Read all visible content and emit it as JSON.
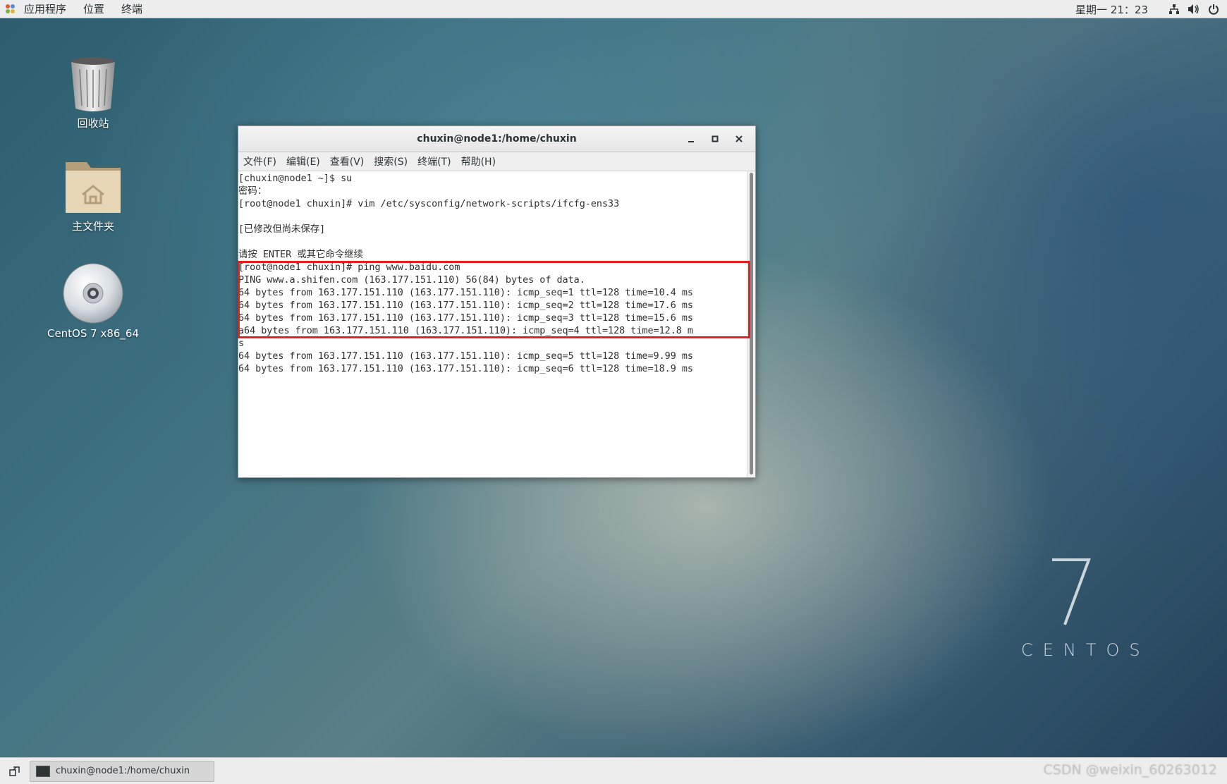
{
  "top_panel": {
    "menus": [
      "应用程序",
      "位置",
      "终端"
    ],
    "clock": "星期一 21：23",
    "tray_icons": [
      "network-icon",
      "volume-icon",
      "power-icon"
    ]
  },
  "desktop": {
    "icons": [
      {
        "label": "回收站",
        "icon": "trash-icon"
      },
      {
        "label": "主文件夹",
        "icon": "home-folder-icon"
      },
      {
        "label": "CentOS 7 x86_64",
        "icon": "disc-icon"
      }
    ],
    "brand_number": "7",
    "brand_word": "CENTOS"
  },
  "window": {
    "title": "chuxin@node1:/home/chuxin",
    "menu": [
      "文件(F)",
      "编辑(E)",
      "查看(V)",
      "搜索(S)",
      "终端(T)",
      "帮助(H)"
    ],
    "lines": [
      "[chuxin@node1 ~]$ su",
      "密码：",
      "[root@node1 chuxin]# vim /etc/sysconfig/network-scripts/ifcfg-ens33",
      "",
      "[已修改但尚未保存]",
      "",
      "请按 ENTER 或其它命令继续",
      "[root@node1 chuxin]# ping www.baidu.com",
      "PING www.a.shifen.com (163.177.151.110) 56(84) bytes of data.",
      "64 bytes from 163.177.151.110 (163.177.151.110): icmp_seq=1 ttl=128 time=10.4 ms",
      "64 bytes from 163.177.151.110 (163.177.151.110): icmp_seq=2 ttl=128 time=17.6 ms",
      "64 bytes from 163.177.151.110 (163.177.151.110): icmp_seq=3 ttl=128 time=15.6 ms",
      "a64 bytes from 163.177.151.110 (163.177.151.110): icmp_seq=4 ttl=128 time=12.8 m",
      "s",
      "64 bytes from 163.177.151.110 (163.177.151.110): icmp_seq=5 ttl=128 time=9.99 ms",
      "64 bytes from 163.177.151.110 (163.177.151.110): icmp_seq=6 ttl=128 time=18.9 ms"
    ]
  },
  "taskbar": {
    "items": [
      "chuxin@node1:/home/chuxin"
    ]
  },
  "watermark": "CSDN @weixin_60263012",
  "colors": {
    "highlight": "#e51f1f",
    "panel": "#ededed"
  }
}
